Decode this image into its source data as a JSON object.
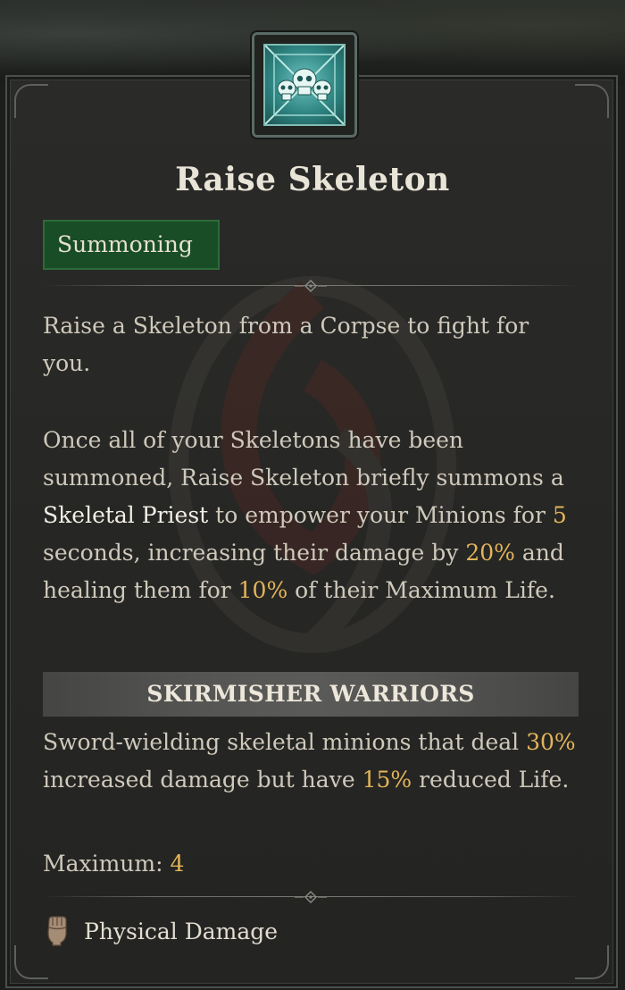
{
  "skill": {
    "icon": "skull-summoning-icon",
    "name": "Raise Skeleton",
    "tag": "Summoning"
  },
  "description": {
    "p1": "Raise a Skeleton from a Corpse to fight for you.",
    "p2": {
      "a": "Once all of your Skeletons have been summoned, Raise Skeleton briefly summons a ",
      "priest": "Skeletal Priest",
      "b": " to empower your Minions for ",
      "seconds": "5",
      "c": " seconds, increasing their damage by ",
      "damage_pct": "20%",
      "d": " and healing them for ",
      "heal_pct": "10%",
      "e": " of their Maximum Life."
    }
  },
  "variant": {
    "title": "SKIRMISHER WARRIORS",
    "a": "Sword-wielding skeletal minions that deal ",
    "damage_pct": "30%",
    "b": " increased damage but have ",
    "life_pct": "15%",
    "c": " reduced Life.",
    "max_label": "Maximum: ",
    "max_value": "4"
  },
  "damage_type": {
    "icon": "fist-icon",
    "label": "Physical Damage"
  },
  "colors": {
    "highlight_gold": "#e3b45a",
    "tag_green": "#184d25",
    "icon_teal": "#2f8683"
  }
}
